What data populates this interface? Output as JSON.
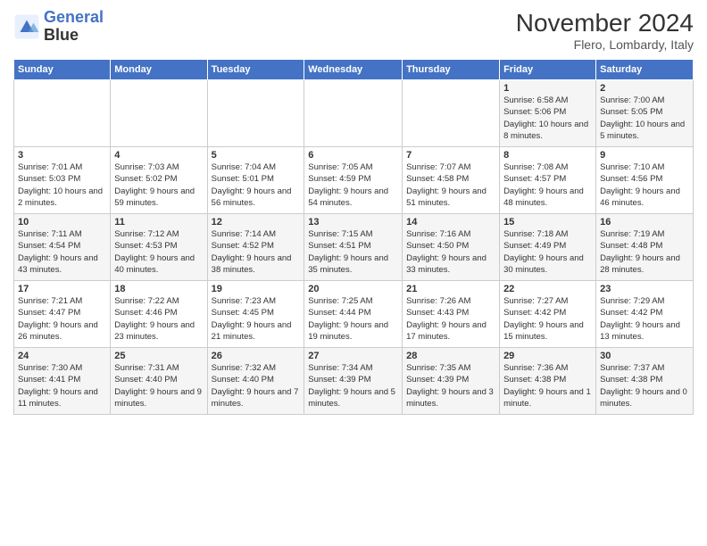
{
  "header": {
    "logo_line1": "General",
    "logo_line2": "Blue",
    "month": "November 2024",
    "location": "Flero, Lombardy, Italy"
  },
  "weekdays": [
    "Sunday",
    "Monday",
    "Tuesday",
    "Wednesday",
    "Thursday",
    "Friday",
    "Saturday"
  ],
  "weeks": [
    [
      {
        "day": "",
        "info": ""
      },
      {
        "day": "",
        "info": ""
      },
      {
        "day": "",
        "info": ""
      },
      {
        "day": "",
        "info": ""
      },
      {
        "day": "",
        "info": ""
      },
      {
        "day": "1",
        "info": "Sunrise: 6:58 AM\nSunset: 5:06 PM\nDaylight: 10 hours and 8 minutes."
      },
      {
        "day": "2",
        "info": "Sunrise: 7:00 AM\nSunset: 5:05 PM\nDaylight: 10 hours and 5 minutes."
      }
    ],
    [
      {
        "day": "3",
        "info": "Sunrise: 7:01 AM\nSunset: 5:03 PM\nDaylight: 10 hours and 2 minutes."
      },
      {
        "day": "4",
        "info": "Sunrise: 7:03 AM\nSunset: 5:02 PM\nDaylight: 9 hours and 59 minutes."
      },
      {
        "day": "5",
        "info": "Sunrise: 7:04 AM\nSunset: 5:01 PM\nDaylight: 9 hours and 56 minutes."
      },
      {
        "day": "6",
        "info": "Sunrise: 7:05 AM\nSunset: 4:59 PM\nDaylight: 9 hours and 54 minutes."
      },
      {
        "day": "7",
        "info": "Sunrise: 7:07 AM\nSunset: 4:58 PM\nDaylight: 9 hours and 51 minutes."
      },
      {
        "day": "8",
        "info": "Sunrise: 7:08 AM\nSunset: 4:57 PM\nDaylight: 9 hours and 48 minutes."
      },
      {
        "day": "9",
        "info": "Sunrise: 7:10 AM\nSunset: 4:56 PM\nDaylight: 9 hours and 46 minutes."
      }
    ],
    [
      {
        "day": "10",
        "info": "Sunrise: 7:11 AM\nSunset: 4:54 PM\nDaylight: 9 hours and 43 minutes."
      },
      {
        "day": "11",
        "info": "Sunrise: 7:12 AM\nSunset: 4:53 PM\nDaylight: 9 hours and 40 minutes."
      },
      {
        "day": "12",
        "info": "Sunrise: 7:14 AM\nSunset: 4:52 PM\nDaylight: 9 hours and 38 minutes."
      },
      {
        "day": "13",
        "info": "Sunrise: 7:15 AM\nSunset: 4:51 PM\nDaylight: 9 hours and 35 minutes."
      },
      {
        "day": "14",
        "info": "Sunrise: 7:16 AM\nSunset: 4:50 PM\nDaylight: 9 hours and 33 minutes."
      },
      {
        "day": "15",
        "info": "Sunrise: 7:18 AM\nSunset: 4:49 PM\nDaylight: 9 hours and 30 minutes."
      },
      {
        "day": "16",
        "info": "Sunrise: 7:19 AM\nSunset: 4:48 PM\nDaylight: 9 hours and 28 minutes."
      }
    ],
    [
      {
        "day": "17",
        "info": "Sunrise: 7:21 AM\nSunset: 4:47 PM\nDaylight: 9 hours and 26 minutes."
      },
      {
        "day": "18",
        "info": "Sunrise: 7:22 AM\nSunset: 4:46 PM\nDaylight: 9 hours and 23 minutes."
      },
      {
        "day": "19",
        "info": "Sunrise: 7:23 AM\nSunset: 4:45 PM\nDaylight: 9 hours and 21 minutes."
      },
      {
        "day": "20",
        "info": "Sunrise: 7:25 AM\nSunset: 4:44 PM\nDaylight: 9 hours and 19 minutes."
      },
      {
        "day": "21",
        "info": "Sunrise: 7:26 AM\nSunset: 4:43 PM\nDaylight: 9 hours and 17 minutes."
      },
      {
        "day": "22",
        "info": "Sunrise: 7:27 AM\nSunset: 4:42 PM\nDaylight: 9 hours and 15 minutes."
      },
      {
        "day": "23",
        "info": "Sunrise: 7:29 AM\nSunset: 4:42 PM\nDaylight: 9 hours and 13 minutes."
      }
    ],
    [
      {
        "day": "24",
        "info": "Sunrise: 7:30 AM\nSunset: 4:41 PM\nDaylight: 9 hours and 11 minutes."
      },
      {
        "day": "25",
        "info": "Sunrise: 7:31 AM\nSunset: 4:40 PM\nDaylight: 9 hours and 9 minutes."
      },
      {
        "day": "26",
        "info": "Sunrise: 7:32 AM\nSunset: 4:40 PM\nDaylight: 9 hours and 7 minutes."
      },
      {
        "day": "27",
        "info": "Sunrise: 7:34 AM\nSunset: 4:39 PM\nDaylight: 9 hours and 5 minutes."
      },
      {
        "day": "28",
        "info": "Sunrise: 7:35 AM\nSunset: 4:39 PM\nDaylight: 9 hours and 3 minutes."
      },
      {
        "day": "29",
        "info": "Sunrise: 7:36 AM\nSunset: 4:38 PM\nDaylight: 9 hours and 1 minute."
      },
      {
        "day": "30",
        "info": "Sunrise: 7:37 AM\nSunset: 4:38 PM\nDaylight: 9 hours and 0 minutes."
      }
    ]
  ]
}
